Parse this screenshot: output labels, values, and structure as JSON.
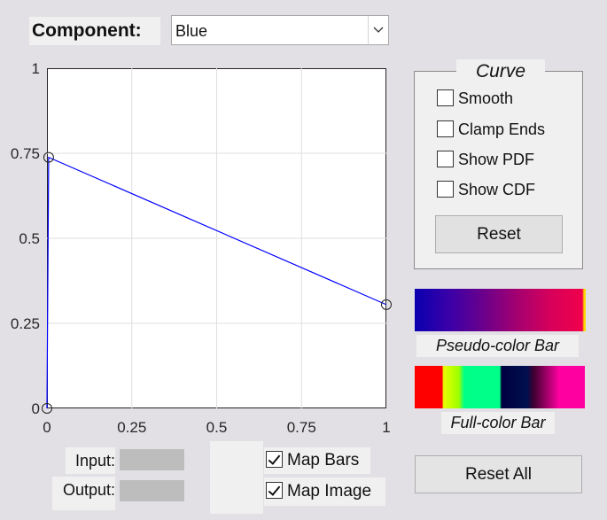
{
  "component": {
    "label": "Component:",
    "selected": "Blue"
  },
  "curve_panel": {
    "title": "Curve",
    "options": [
      {
        "label": "Smooth",
        "checked": false
      },
      {
        "label": "Clamp Ends",
        "checked": false
      },
      {
        "label": "Show PDF",
        "checked": false
      },
      {
        "label": "Show CDF",
        "checked": false
      }
    ],
    "reset_label": "Reset"
  },
  "color_bars": {
    "pseudo_caption": "Pseudo-color Bar",
    "full_caption": "Full-color Bar"
  },
  "io": {
    "input_label": "Input:",
    "output_label": "Output:",
    "input_value": "",
    "output_value": ""
  },
  "map_options": {
    "map_bars_label": "Map Bars",
    "map_bars_checked": true,
    "map_image_label": "Map Image",
    "map_image_checked": true
  },
  "reset_all_label": "Reset All",
  "chart_data": {
    "type": "line",
    "x_ticks": [
      "0",
      "0.25",
      "0.5",
      "0.75",
      "1"
    ],
    "y_ticks": [
      "0",
      "0.25",
      "0.5",
      "0.75",
      "1"
    ],
    "xlim": [
      0,
      1
    ],
    "ylim": [
      0,
      1
    ],
    "grid": true,
    "series": [
      {
        "color": "#0000ff",
        "marker": "circle",
        "x": [
          0,
          0.005,
          1
        ],
        "y": [
          0,
          0.738,
          0.305
        ]
      }
    ]
  }
}
